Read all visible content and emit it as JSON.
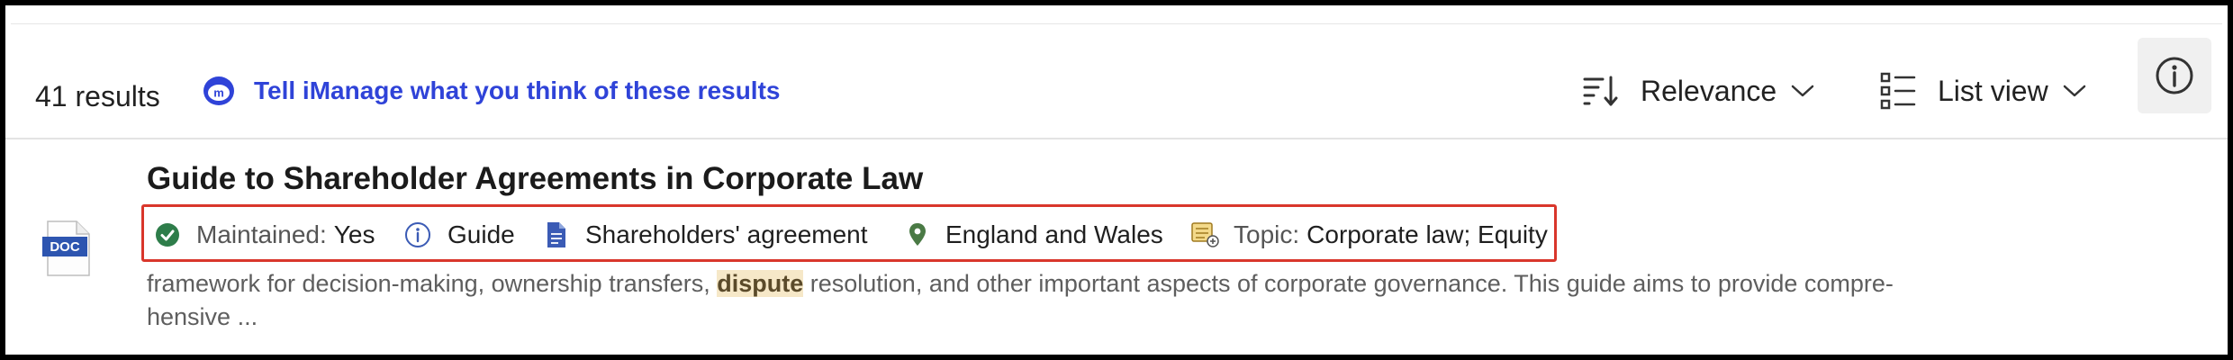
{
  "toolbar": {
    "results_count": "41 results",
    "feedback_link": "Tell iManage what you think of these results",
    "sort_label": "Relevance",
    "view_label": "List view",
    "sort_icon": "sort-descending-icon",
    "view_icon": "list-view-icon",
    "info_icon": "info-icon"
  },
  "result": {
    "doc_badge": "DOC",
    "title": "Guide to Shareholder Agreements in Corporate Law",
    "meta": {
      "maintained_key": "Maintained:",
      "maintained_val": "Yes",
      "type": "Guide",
      "doc_type": "Shareholders' agreement",
      "jurisdiction": "England and Wales",
      "topic_key": "Topic:",
      "topic_val": "Corporate law; Equity"
    },
    "snippet": {
      "before": "framework for decision-making, ownership transfers, ",
      "highlight": "dispute",
      "after": " resolution, and other important aspects of corporate governance. This guide aims to provide compre-",
      "line2": "hensive ..."
    }
  },
  "colors": {
    "link": "#2f43d8",
    "highlight_bg": "#f6e8c8",
    "annotation_box": "#d9362b",
    "check": "#2e7d4a",
    "doc_blue": "#3b5bb5",
    "pin_green": "#4a7a45"
  }
}
